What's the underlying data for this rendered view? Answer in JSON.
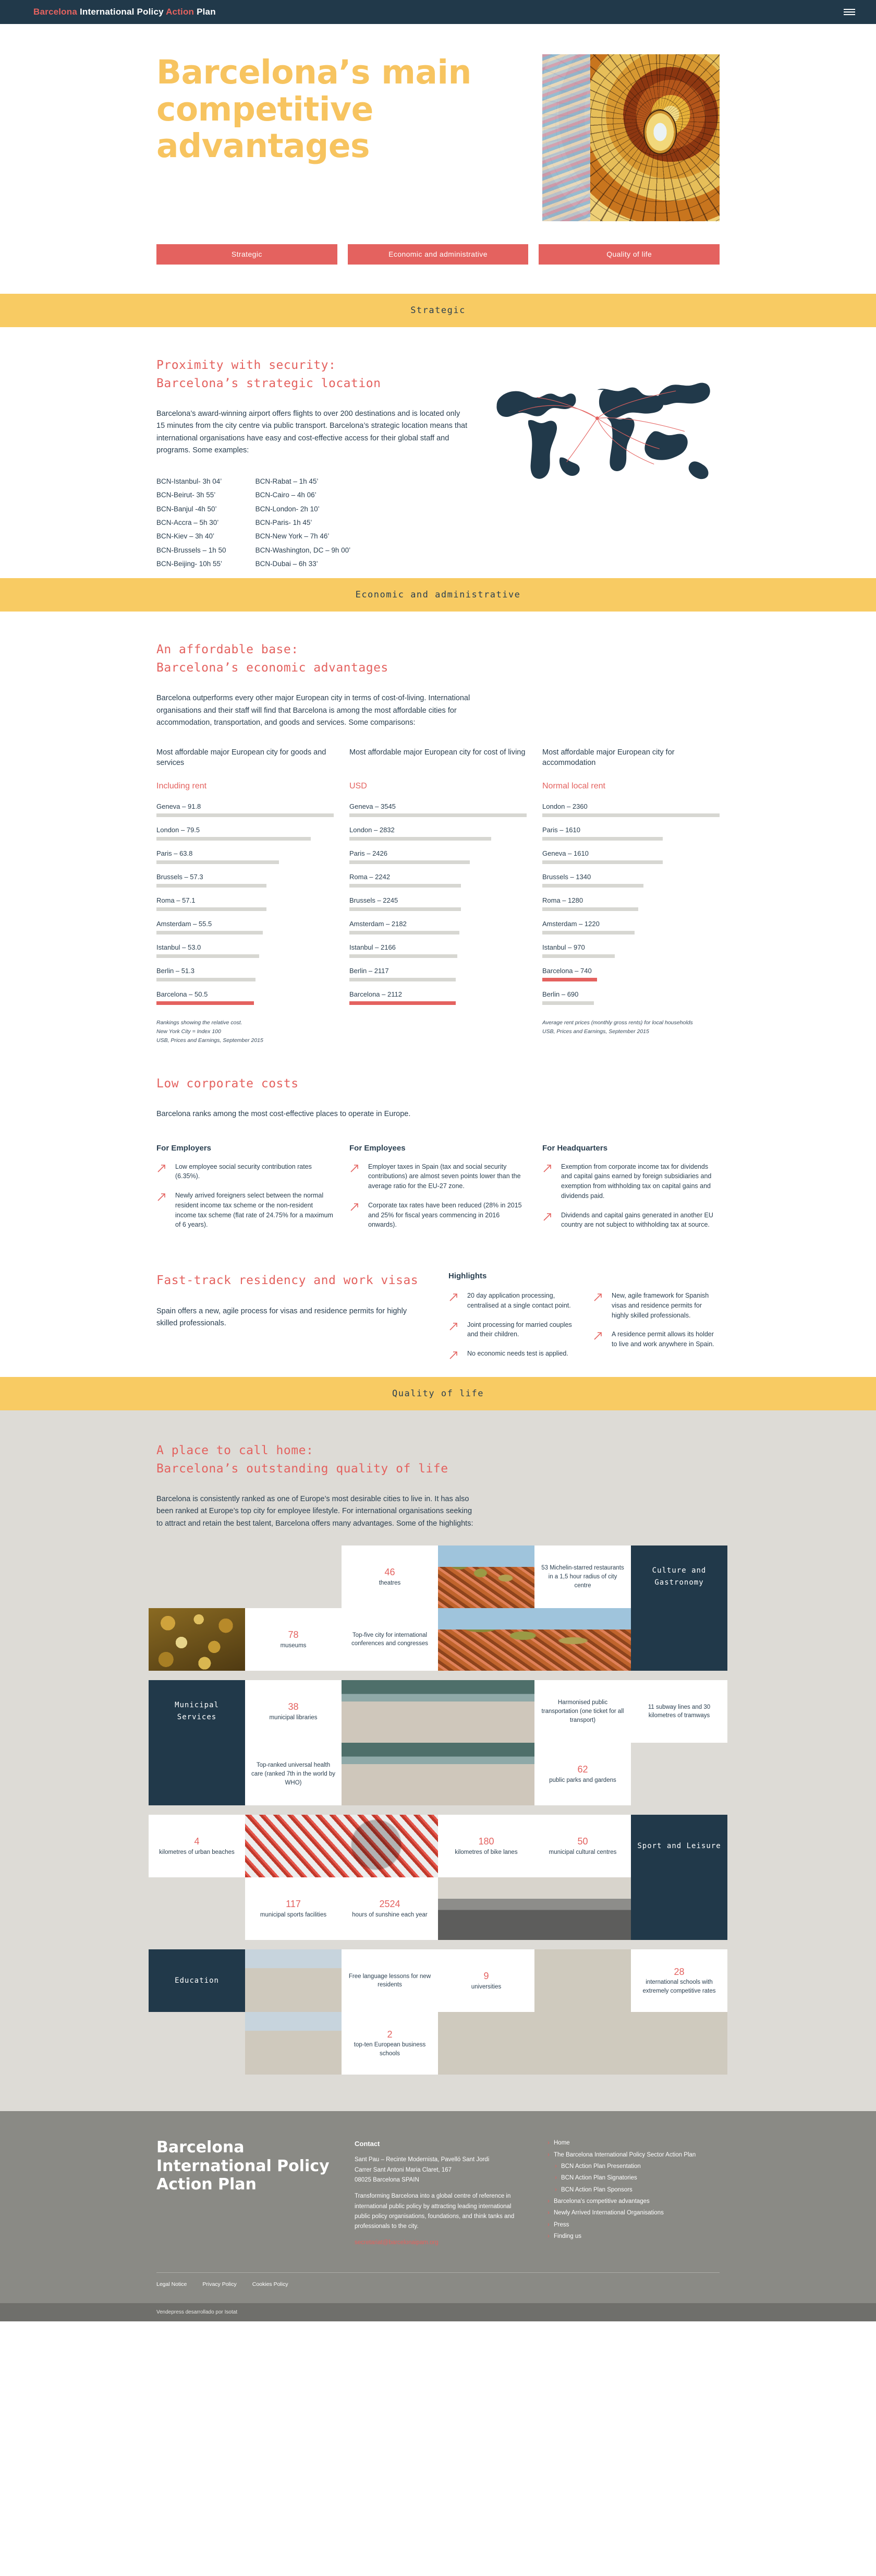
{
  "nav": {
    "brand_part1": "Barcelona",
    "brand_part2": "International Policy",
    "brand_part3": "Action",
    "brand_part4": "Plan",
    "menu_icon": "hamburger-icon"
  },
  "hero": {
    "title": "Barcelona’s main competitive advantages",
    "image_alt": "palau-de-la-musica-stained-glass-dome",
    "pills": [
      {
        "label": "Strategic"
      },
      {
        "label": "Economic and administrative"
      },
      {
        "label": "Quality of life"
      }
    ]
  },
  "bands": {
    "strategic": "Strategic",
    "economic": "Economic and administrative",
    "quality": "Quality of life"
  },
  "strategic": {
    "heading": "Proximity with security:\nBarcelona’s strategic location",
    "body": "Barcelona’s award-winning airport offers flights to over 200 destinations and is located only 15 minutes from the city centre via public transport. Barcelona’s strategic location means that international organisations have easy and cost-effective access for their global staff and programs. Some examples:",
    "flights_left": [
      "BCN-Istanbul- 3h 04’",
      "BCN-Beirut- 3h 55’",
      "BCN-Banjul -4h 50’",
      "BCN-Accra – 5h 30’",
      "BCN-Kiev – 3h 40’",
      "BCN-Brussels – 1h 50",
      "BCN-Beijing- 10h 55’"
    ],
    "flights_right": [
      "BCN-Rabat – 1h 45’",
      "BCN-Cairo – 4h 06’",
      "BCN-London- 2h 10’",
      "BCN-Paris- 1h 45’",
      "BCN-New York – 7h 46’",
      "BCN-Washington, DC – 9h 00’",
      "BCN-Dubai – 6h 33’"
    ],
    "map_icon": "world-map-flight-routes"
  },
  "economic": {
    "heading": "An affordable base:\nBarcelona’s economic advantages",
    "body": "Barcelona outperforms every other major European city in terms of cost-of-living. International organisations and their staff will find that Barcelona is among the most affordable cities for accommodation, transportation, and goods and services. Some comparisons:"
  },
  "chart_data": [
    {
      "type": "bar",
      "title": "Most affordable major European city for goods and services",
      "subtitle": "Including rent",
      "orientation": "horizontal",
      "highlight": "Barcelona",
      "highlight_color": "#e4625f",
      "bar_color": "#d7d7d2",
      "xlabel": "",
      "ylabel": "",
      "max": 91.8,
      "categories": [
        "Geneva",
        "London",
        "Paris",
        "Brussels",
        "Roma",
        "Amsterdam",
        "Istanbul",
        "Berlin",
        "Barcelona"
      ],
      "values": [
        91.8,
        79.5,
        63.8,
        57.3,
        57.1,
        55.5,
        53.0,
        51.3,
        50.5
      ],
      "labels": [
        "Geneva – 91.8",
        "London – 79.5",
        "Paris – 63.8",
        "Brussels – 57.3",
        "Roma – 57.1",
        "Amsterdam – 55.5",
        "Istanbul – 53.0",
        "Berlin – 51.3",
        "Barcelona – 50.5"
      ],
      "note": "Rankings showing the relative cost.\nNew York City = Index 100\nUSB, Prices and Earnings, September 2015"
    },
    {
      "type": "bar",
      "title": "Most affordable major European city for cost of living",
      "subtitle": "USD",
      "orientation": "horizontal",
      "highlight": "Barcelona",
      "highlight_color": "#e4625f",
      "bar_color": "#d7d7d2",
      "xlabel": "",
      "ylabel": "",
      "max": 3545,
      "categories": [
        "Geneva",
        "London",
        "Paris",
        "Roma",
        "Brussels",
        "Amsterdam",
        "Istanbul",
        "Berlin",
        "Barcelona"
      ],
      "values": [
        3545,
        2832,
        2426,
        2242,
        2245,
        2182,
        2166,
        2117,
        2112
      ],
      "labels": [
        "Geneva – 3545",
        "London – 2832",
        "Paris – 2426",
        "Roma – 2242",
        "Brussels – 2245",
        "Amsterdam – 2182",
        "Istanbul – 2166",
        "Berlin – 2117",
        "Barcelona – 2112"
      ],
      "note": ""
    },
    {
      "type": "bar",
      "title": "Most affordable major European city for accommodation",
      "subtitle": "Normal local rent",
      "orientation": "horizontal",
      "highlight": "Barcelona",
      "highlight_color": "#e4625f",
      "bar_color": "#d7d7d2",
      "xlabel": "",
      "ylabel": "",
      "max": 2360,
      "categories": [
        "London",
        "Paris",
        "Geneva",
        "Brussels",
        "Roma",
        "Amsterdam",
        "Istanbul",
        "Barcelona",
        "Berlin"
      ],
      "values": [
        2360,
        1610,
        1610,
        1340,
        1280,
        1220,
        970,
        740,
        690
      ],
      "labels": [
        "London – 2360",
        "Paris – 1610",
        "Geneva – 1610",
        "Brussels – 1340",
        "Roma – 1280",
        "Amsterdam – 1220",
        "Istanbul – 970",
        "Barcelona – 740",
        "Berlin – 690"
      ],
      "note": "Average rent prices (monthly gross rents) for local households\nUSB, Prices and Earnings, September 2015"
    }
  ],
  "corporate": {
    "heading": "Low corporate costs",
    "body": "Barcelona ranks among the most cost-effective places to operate in Europe.",
    "groups": [
      {
        "title": "For Employers",
        "items": [
          "Low employee social security contribution rates (6.35%).",
          "Newly arrived foreigners select between the normal resident income tax scheme or the non-resident income tax scheme (flat rate of 24.75% for a maximum of 6 years)."
        ]
      },
      {
        "title": "For Employees",
        "items": [
          "Employer taxes in Spain (tax and social security contributions) are almost seven points lower than the average ratio for the EU-27 zone.",
          "Corporate tax rates have been reduced (28% in 2015 and 25% for fiscal years commencing in 2016 onwards)."
        ]
      },
      {
        "title": "For Headquarters",
        "items": [
          "Exemption from corporate income tax for dividends and capital gains earned by foreign subsidiaries and exemption from withholding tax on capital gains and dividends paid.",
          "Dividends and capital gains generated in another EU country are not subject to withholding tax at source."
        ]
      }
    ]
  },
  "visas": {
    "heading": "Fast-track residency and work visas",
    "body": "Spain offers a new, agile process for visas and residence permits for highly skilled professionals.",
    "highlights_title": "Highlights",
    "highlights_left": [
      "20 day application processing, centralised at a single contact point.",
      "Joint processing for married couples and their children.",
      "No economic needs test is applied."
    ],
    "highlights_right": [
      "New, agile framework for Spanish visas and residence permits for highly skilled professionals.",
      "A residence permit allows its holder to live and work anywhere in Spain."
    ]
  },
  "quality": {
    "heading": "A place to call home:\nBarcelona’s outstanding quality of life",
    "body": "Barcelona is consistently ranked as one of Europe’s most desirable cities to live in. It has also been ranked at Europe’s top city for employee lifestyle. For international organisations seeking to attract and retain the best talent, Barcelona offers many advantages. Some of the highlights:",
    "mosaic": {
      "culture": {
        "category": "Culture and Gastronomy",
        "theatres_num": "46",
        "theatres_txt": "theatres",
        "museums_num": "78",
        "museums_txt": "museums",
        "congress_txt": "Top-five city for international conferences and congresses",
        "michelin_txt": "53 Michelin-starred restaurants in a 1,5 hour radius of city centre",
        "img_lemons": "ceramic-lemons-photo",
        "img_gaudi": "gaudi-mosaic-photo"
      },
      "municipal": {
        "category": "Municipal Services",
        "libraries_num": "38",
        "libraries_txt": "municipal libraries",
        "health_txt": "Top-ranked universal health care (ranked 7th in the world by WHO)",
        "transport_txt": "Harmonised public transportation (one ticket for all transport)",
        "subway_txt": "11 subway lines and 30 kilometres of tramways",
        "parks_num": "62",
        "parks_txt": "public parks and gardens",
        "img_waterfront": "barcelona-waterfront-benches-photo"
      },
      "sport": {
        "category": "Sport and Leisure",
        "beaches_num": "4",
        "beaches_txt": "kilometres of urban beaches",
        "bike_num": "180",
        "bike_txt": "kilometres of bike lanes",
        "cultural_num": "50",
        "cultural_txt": "municipal cultural centres",
        "sports_num": "117",
        "sports_txt": "municipal sports facilities",
        "sun_num": "2524",
        "sun_txt": "hours of sunshine each year",
        "img_bicing": "bicing-bike-photo",
        "img_skate": "skatepark-photo"
      },
      "education": {
        "category": "Education",
        "language_txt": "Free language lessons for new residents",
        "uni_num": "9",
        "uni_txt": "universities",
        "intl_num": "28",
        "intl_txt": "international schools with extremely competitive rates",
        "business_num": "2",
        "business_txt": "top-ten European business schools",
        "img_sagrada": "sagrada-familia-photo",
        "img_university": "university-building-photo",
        "img_cloister": "cloister-arches-photo"
      }
    }
  },
  "footer": {
    "brand": "Barcelona International Policy Action Plan",
    "contact_title": "Contact",
    "contact_lines": [
      "Sant Pau – Recinte Modernista, Pavelló Sant Jordi",
      "Carrer Sant Antoni Maria Claret, 167",
      "08025 Barcelona SPAIN"
    ],
    "contact_body": "Transforming Barcelona into a global centre of reference in international public policy by attracting leading international public policy organisations, foundations, and think tanks and professionals to the city.",
    "contact_mail": "secretariat@barcelonaipam.org",
    "links": [
      {
        "label": "Home",
        "sub": false
      },
      {
        "label": "The Barcelona International Policy Sector Action Plan",
        "sub": false
      },
      {
        "label": "BCN Action Plan Presentation",
        "sub": true
      },
      {
        "label": "BCN Action Plan Signatories",
        "sub": true
      },
      {
        "label": "BCN Action Plan Sponsors",
        "sub": true
      },
      {
        "label": "Barcelona's competitive advantages",
        "sub": false
      },
      {
        "label": "Newly Arrived International Organisations",
        "sub": false
      },
      {
        "label": "Press",
        "sub": false
      },
      {
        "label": "Finding us",
        "sub": false
      }
    ],
    "bar_links": [
      "Legal Notice",
      "Privacy Policy",
      "Cookies Policy"
    ],
    "bottom_note": "Vendepress desarrollado por Isotat"
  }
}
